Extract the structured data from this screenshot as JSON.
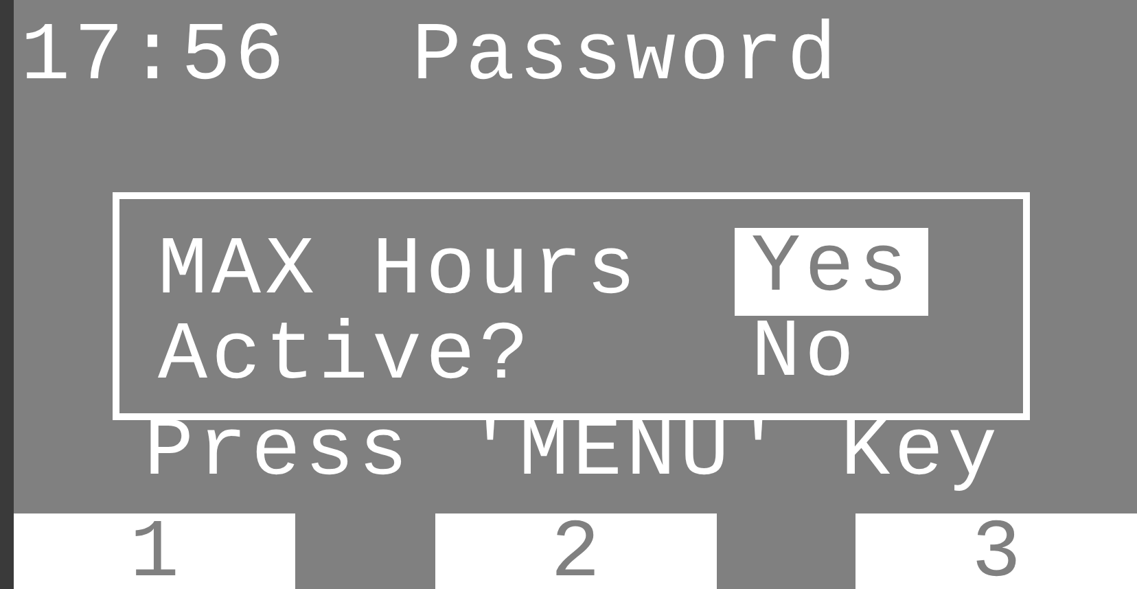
{
  "header": {
    "time": "17:56",
    "title": "Password"
  },
  "dialog": {
    "lines": [
      {
        "label": "MAX Hours",
        "option": {
          "text": "Yes",
          "selected": true
        }
      },
      {
        "label": "Active?",
        "option": {
          "text": "No",
          "selected": false
        }
      }
    ]
  },
  "prompt": "Press 'MENU' Key",
  "softkeys": [
    "1",
    "2",
    "3"
  ]
}
